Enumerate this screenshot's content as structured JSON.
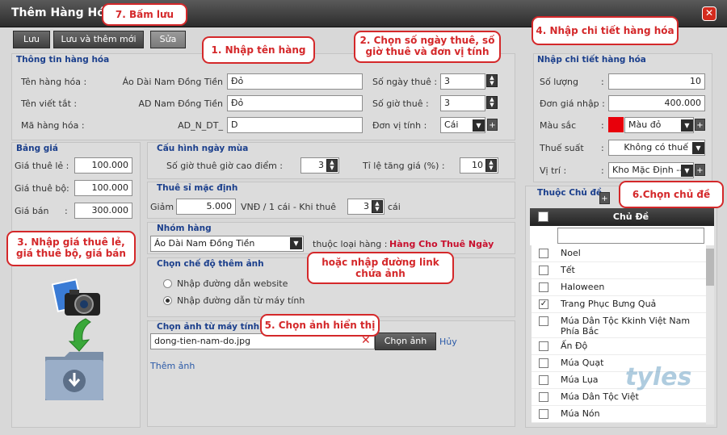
{
  "window": {
    "title": "Thêm Hàng Hóa"
  },
  "toolbar": {
    "save": "Lưu",
    "save_new": "Lưu và thêm mới",
    "edit": "Sửa"
  },
  "product": {
    "section": "Thông tin hàng hóa",
    "name_label": "Tên hàng hóa :",
    "name_hint": "Áo Dài Nam Đồng Tiền",
    "name_value": "Đỏ",
    "short_label": "Tên viết tắt :",
    "short_hint": "AD Nam Đồng Tiền",
    "short_value": "Đỏ",
    "code_label": "Mã hàng hóa :",
    "code_hint": "AD_N_DT_",
    "code_value": "D",
    "days_label": "Số ngày thuê :",
    "days_value": "3",
    "hours_label": "Số giờ thuê :",
    "hours_value": "3",
    "unit_label": "Đơn vị tính :",
    "unit_value": "Cái"
  },
  "detail": {
    "section": "Nhập chi tiết hàng hóa",
    "qty_label": "Số lượng",
    "qty_value": "10",
    "price_label": "Đơn giá nhập :",
    "price_value": "400.000",
    "color_label": "Màu sắc",
    "color_value": "Màu đỏ",
    "color_swatch": "#e8000b",
    "tax_label": "Thuế suất",
    "tax_value": "Không có thuế",
    "loc_label": "Vị trí :",
    "loc_value": "Kho Mặc Định --"
  },
  "pricing": {
    "section": "Bảng giá",
    "retail_label": "Giá thuê lẻ :",
    "retail_value": "100.000",
    "set_label": "Giá thuê bộ:",
    "set_value": "100.000",
    "sale_label": "Giá bán",
    "sale_value": "300.000"
  },
  "season": {
    "section": "Cấu hình ngày mùa",
    "peak_label": "Số giờ thuê giờ cao điểm :",
    "peak_value": "3",
    "rate_label": "Tỉ lệ tăng giá (%) :",
    "rate_value": "10"
  },
  "default_rent": {
    "section": "Thuê sỉ mặc định",
    "discount_label": "Giảm",
    "discount_value": "5.000",
    "unit_text": "VNĐ / 1 cái  -  Khi thuê",
    "qty_value": "3",
    "qty_unit": "cái"
  },
  "group": {
    "section": "Nhóm hàng",
    "value": "Áo Dài Nam Đồng Tiền",
    "type_label": "thuộc loại hàng :",
    "type_value": "Hàng Cho Thuê Ngày"
  },
  "image_mode": {
    "section": "Chọn chế độ thêm ảnh",
    "opt_web": "Nhập đường dẫn website",
    "opt_local": "Nhập đường dẫn từ máy tính"
  },
  "image_pick": {
    "section": "Chọn ảnh từ máy tính :",
    "file": "dong-tien-nam-do.jpg",
    "choose": "Chọn ảnh",
    "cancel": "Hủy",
    "add": "Thêm ảnh"
  },
  "topics": {
    "section": "Thuộc Chủ đề",
    "header": "Chủ Đề",
    "items": [
      {
        "label": "Noel",
        "checked": false
      },
      {
        "label": "Tết",
        "checked": false
      },
      {
        "label": "Haloween",
        "checked": false
      },
      {
        "label": "Trang Phục Bưng Quả",
        "checked": true
      },
      {
        "label": "Múa Dân Tộc Kkinh Việt Nam Phía Bắc",
        "checked": false
      },
      {
        "label": "Ấn Độ",
        "checked": false
      },
      {
        "label": "Múa Quạt",
        "checked": false
      },
      {
        "label": "Múa Lụa",
        "checked": false
      },
      {
        "label": "Múa Dân Tộc Việt",
        "checked": false
      },
      {
        "label": "Múa Nón",
        "checked": false
      }
    ]
  },
  "callouts": {
    "c1": "1. Nhập tên hàng",
    "c2": "2. Chọn số ngày thuê, số giờ thuê và đơn vị tính",
    "c3": "3. Nhập giá thuê lẻ, giá thuê bộ, giá bán",
    "c4": "4. Nhập chi tiết hàng hóa",
    "c5": "5. Chọn ảnh hiển thị",
    "c6": "6.Chọn chủ đề",
    "c7": "7. Bấm lưu",
    "c8": "hoặc nhập đường link chứa ảnh"
  },
  "watermark": "tyles"
}
